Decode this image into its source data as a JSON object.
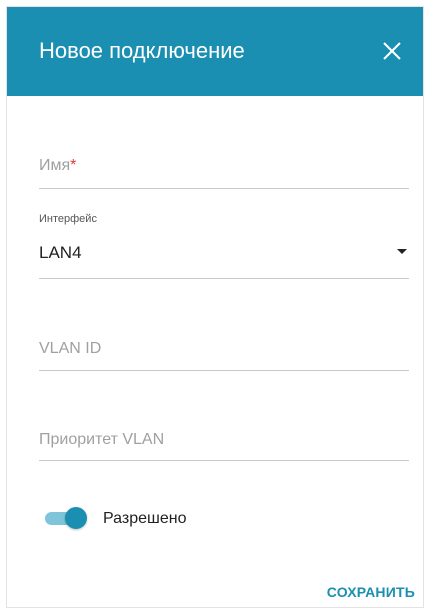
{
  "dialog": {
    "title": "Новое подключение",
    "close_icon": "close-icon",
    "header_color": "#1a8fb1"
  },
  "form": {
    "name": {
      "placeholder": "Имя",
      "required_mark": "*",
      "value": ""
    },
    "interface": {
      "label": "Интерфейс",
      "selected": "LAN4",
      "icon": "caret-down-icon"
    },
    "vlan_id": {
      "placeholder": "VLAN ID",
      "value": ""
    },
    "vlan_priority": {
      "placeholder": "Приоритет VLAN",
      "value": ""
    },
    "enabled": {
      "label": "Разрешено",
      "state": true
    }
  },
  "actions": {
    "save_label": "СОХРАНИТЬ"
  },
  "colors": {
    "accent": "#1a8fb1",
    "required": "#e53935"
  }
}
